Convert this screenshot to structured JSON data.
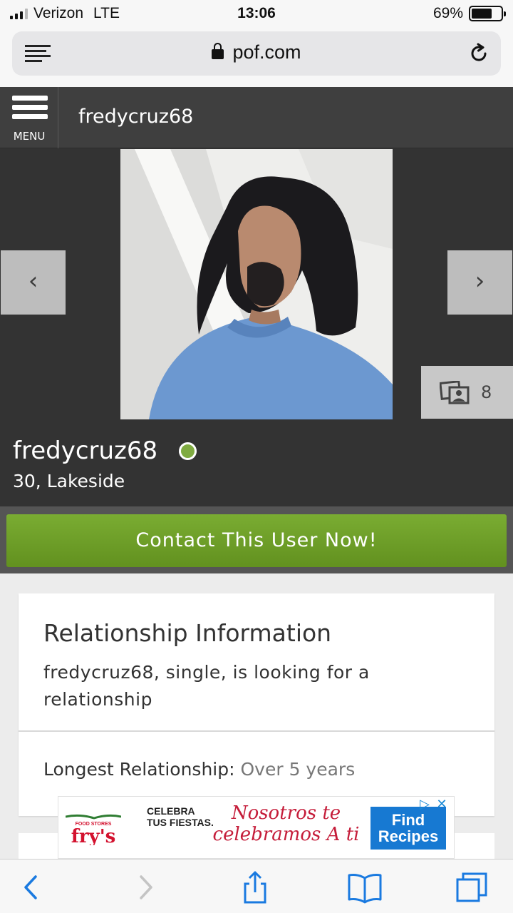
{
  "status_bar": {
    "carrier": "Verizon",
    "network": "LTE",
    "time": "13:06",
    "battery": "69%",
    "battery_level": 0.69
  },
  "browser": {
    "url": "pof.com"
  },
  "site_header": {
    "menu_label": "MENU",
    "title": "fredycruz68"
  },
  "gallery": {
    "prev_symbol": "‹",
    "next_symbol": "›",
    "photo_count": "8"
  },
  "profile": {
    "username": "fredycruz68",
    "age_location": "30, Lakeside",
    "online_status_color": "#7fab41"
  },
  "contact_button": {
    "label": "Contact This User Now!"
  },
  "relationship": {
    "title": "Relationship Information",
    "description": "fredycruz68, single, is looking for a relationship",
    "longest_label": "Longest Relationship:",
    "longest_value": "Over 5 years"
  },
  "ad": {
    "brand": "fry's",
    "brand_tag": "FOOD STORES",
    "headline_1": "CELEBRA",
    "headline_2": "TUS FIESTAS.",
    "script_1": "Nosotros te",
    "script_2": "celebramos A ti",
    "cta_1": "Find",
    "cta_2": "Recipes"
  },
  "colors": {
    "accent_green": "#6fa02a",
    "header_dark": "#3f3f3f",
    "ad_red": "#c51d3a",
    "ad_blue": "#1779d2",
    "ios_blue": "#1a7ae0"
  }
}
